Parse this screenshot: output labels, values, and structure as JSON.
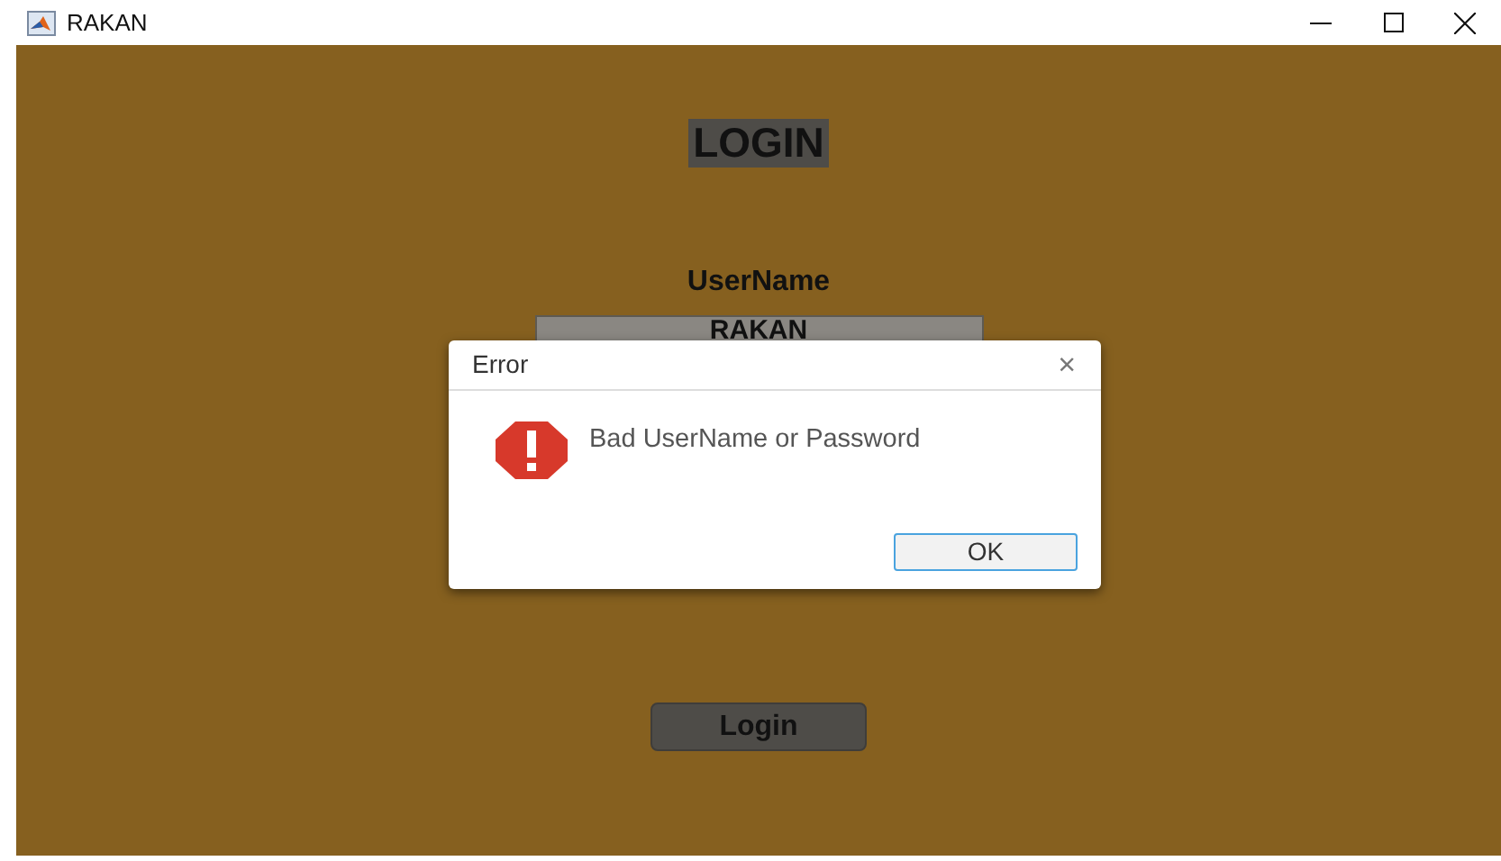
{
  "window": {
    "title": "RAKAN"
  },
  "form": {
    "heading": "LOGIN",
    "username_label": "UserName",
    "username_value": "RAKAN",
    "login_button": "Login"
  },
  "dialog": {
    "title": "Error",
    "close": "×",
    "message": "Bad UserName or Password",
    "kind": "error",
    "ok_button": "OK"
  }
}
